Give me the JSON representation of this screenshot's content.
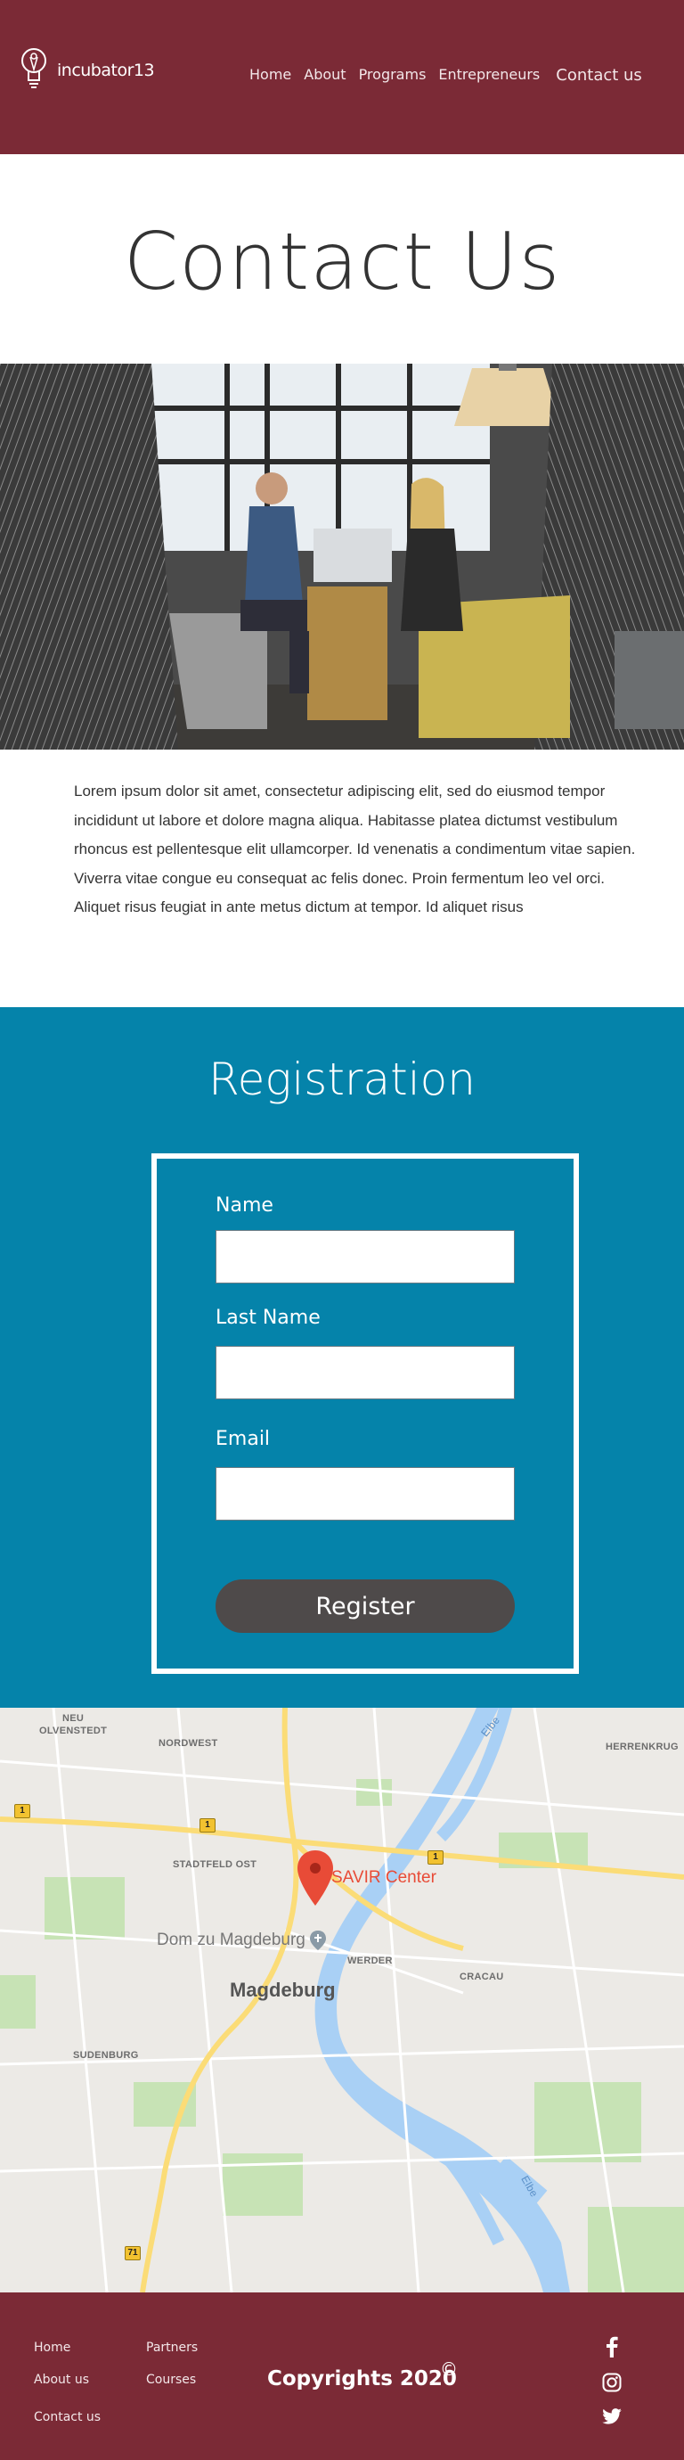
{
  "header": {
    "logo_text": "incubator13",
    "nav": [
      "Home",
      "About",
      "Programs",
      "Entrepreneurs",
      "Contact us"
    ]
  },
  "page_title": "Contact Us",
  "intro_text": "Lorem ipsum dolor sit amet, consectetur adipiscing elit, sed do eiusmod tempor incididunt ut labore et dolore magna aliqua. Habitasse platea dictumst vestibulum rhoncus est pellentesque elit ullamcorper. Id venenatis a condimentum vitae sapien. Viverra vitae congue eu consequat ac felis donec. Proin fermentum leo vel orci. Aliquet risus feugiat in ante metus dictum at tempor. Id aliquet risus",
  "registration": {
    "title": "Registration",
    "fields": [
      {
        "label": "Name",
        "value": ""
      },
      {
        "label": "Last Name",
        "value": ""
      },
      {
        "label": "Email",
        "value": ""
      }
    ],
    "submit_label": "Register"
  },
  "map": {
    "labels": {
      "neu_olvenstedt_1": "NEU",
      "neu_olvenstedt_2": "OLVENSTEDT",
      "nordwest": "NORDWEST",
      "herrenkrug": "HERRENKRUG",
      "stadtfeld_ost": "STADTFELD OST",
      "werder": "WERDER",
      "cracau": "CRACAU",
      "sudenburg": "SUDENBURG",
      "city": "Magdeburg",
      "poi": "Dom zu Magdeburg",
      "marker": "SAVIR Center",
      "river_top": "Elbe",
      "river_bottom": "Elbe"
    },
    "road_shields": [
      "1",
      "1",
      "1",
      "71"
    ],
    "colors": {
      "water": "#a9d0f5",
      "park": "#c7e3b5",
      "road": "#fbdc77"
    }
  },
  "footer": {
    "links": [
      "Home",
      "Partners",
      "About us",
      "Courses",
      "Contact us"
    ],
    "copyright": "Copyrights 2020",
    "copyright_symbol": "©",
    "social_icons": [
      "facebook-icon",
      "instagram-icon",
      "twitter-icon"
    ]
  },
  "colors": {
    "header_bg": "#7b2a36",
    "registration_bg": "#0583aa",
    "button_bg": "#4e4a4a"
  }
}
